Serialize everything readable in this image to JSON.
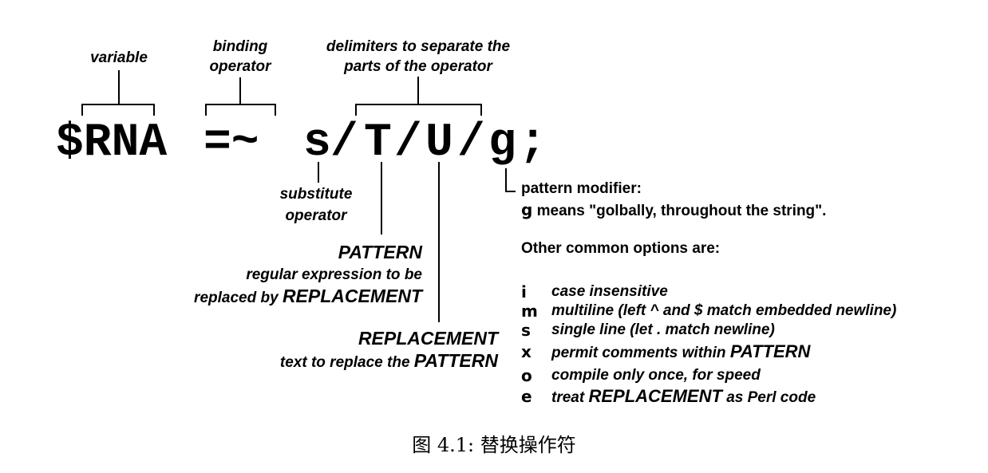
{
  "labels": {
    "variable": "variable",
    "binding_line1": "binding",
    "binding_line2": "operator",
    "delim_line1": "delimiters to separate the",
    "delim_line2": "parts of the operator",
    "substitute_line1": "substitute",
    "substitute_line2": "operator",
    "pattern_title": "PATTERN",
    "pattern_line1": "regular expression to be",
    "pattern_line2_pre": "replaced by ",
    "pattern_line2_emph": "REPLACEMENT",
    "replacement_title": "REPLACEMENT",
    "replacement_line_pre": "text to replace the ",
    "replacement_line_emph": "PATTERN"
  },
  "expression": {
    "var": "$RNA",
    "op": "=~",
    "s": "s",
    "slash1": "/",
    "pattern": "T",
    "slash2": "/",
    "replacement": "U",
    "slash3": "/",
    "modifier": "g",
    "semicolon": ";"
  },
  "modifier_note": {
    "line1": "pattern modifier:",
    "key": "g",
    "line2_rest": " means \"golbally, throughout the string\".",
    "options_heading": "Other common options are:"
  },
  "options": [
    {
      "key": "i",
      "desc": "case insensitive",
      "emph": "",
      "after": ""
    },
    {
      "key": "m",
      "desc": "multiline (left ^ and $ match embedded newline)",
      "emph": "",
      "after": ""
    },
    {
      "key": "s",
      "desc": "single line (let . match newline)",
      "emph": "",
      "after": ""
    },
    {
      "key": "x",
      "desc": "permit comments within ",
      "emph": "PATTERN",
      "after": ""
    },
    {
      "key": "o",
      "desc": "compile only once, for speed",
      "emph": "",
      "after": ""
    },
    {
      "key": "e",
      "desc": "treat ",
      "emph": "REPLACEMENT",
      "after": " as Perl code"
    }
  ],
  "caption": "图 4.1: 替换操作符"
}
